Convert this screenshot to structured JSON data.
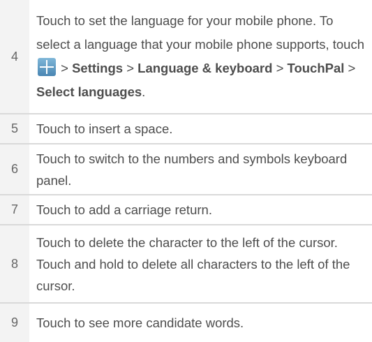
{
  "rows": [
    {
      "number": "4",
      "text_a": "Touch to set the language for your mobile phone. To select a language that your mobile phone supports, touch ",
      "icon": "grid-menu-icon",
      "text_b": " > ",
      "settings": "Settings",
      "sep1": " > ",
      "language_keyboard": "Language & keyboard",
      "sep2": " > ",
      "touchpal": "TouchPal",
      "sep3": " > ",
      "select_languages": "Select languages",
      "end": "."
    },
    {
      "number": "5",
      "text": "Touch to insert a space."
    },
    {
      "number": "6",
      "text": "Touch to switch to the numbers and symbols keyboard panel."
    },
    {
      "number": "7",
      "text": "Touch to add a carriage return."
    },
    {
      "number": "8",
      "text": "Touch to delete the character to the left of the cursor. Touch and hold to delete all characters to the left of the cursor."
    },
    {
      "number": "9",
      "text": "Touch to see more candidate words."
    }
  ]
}
